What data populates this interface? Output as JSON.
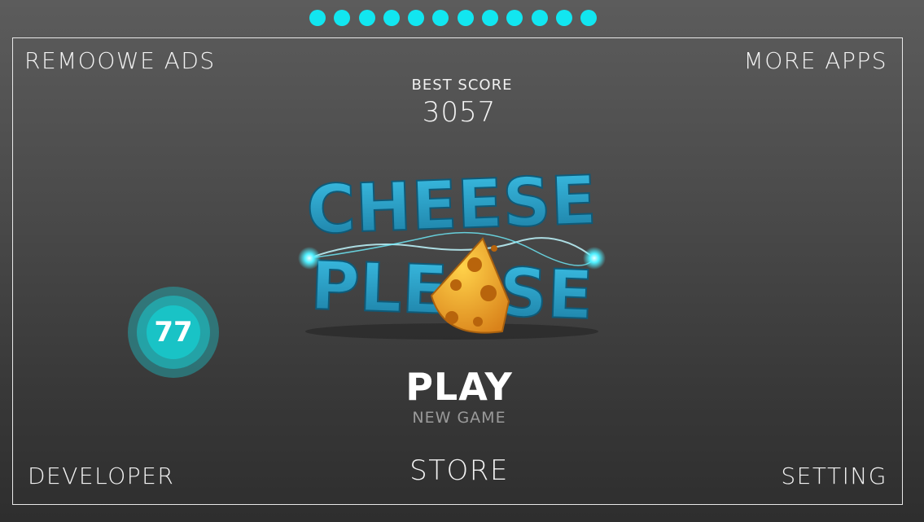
{
  "progress_dots": {
    "count": 12,
    "color": "#12e6f0"
  },
  "menu": {
    "remove_ads": "REMOOWE ADS",
    "more_apps": "MORE APPS",
    "developer": "DEVELOPER",
    "setting": "SETTING",
    "store": "STORE"
  },
  "best_score": {
    "label": "BEST SCORE",
    "value": "3057"
  },
  "logo": {
    "icon": "cheese-please-logo",
    "primary_color": "#2aa0c8",
    "cheese_color": "#f0a020"
  },
  "level_badge": {
    "value": "77",
    "color": "#19c3c6"
  },
  "play": {
    "label": "PLAY",
    "sublabel": "NEW GAME"
  }
}
